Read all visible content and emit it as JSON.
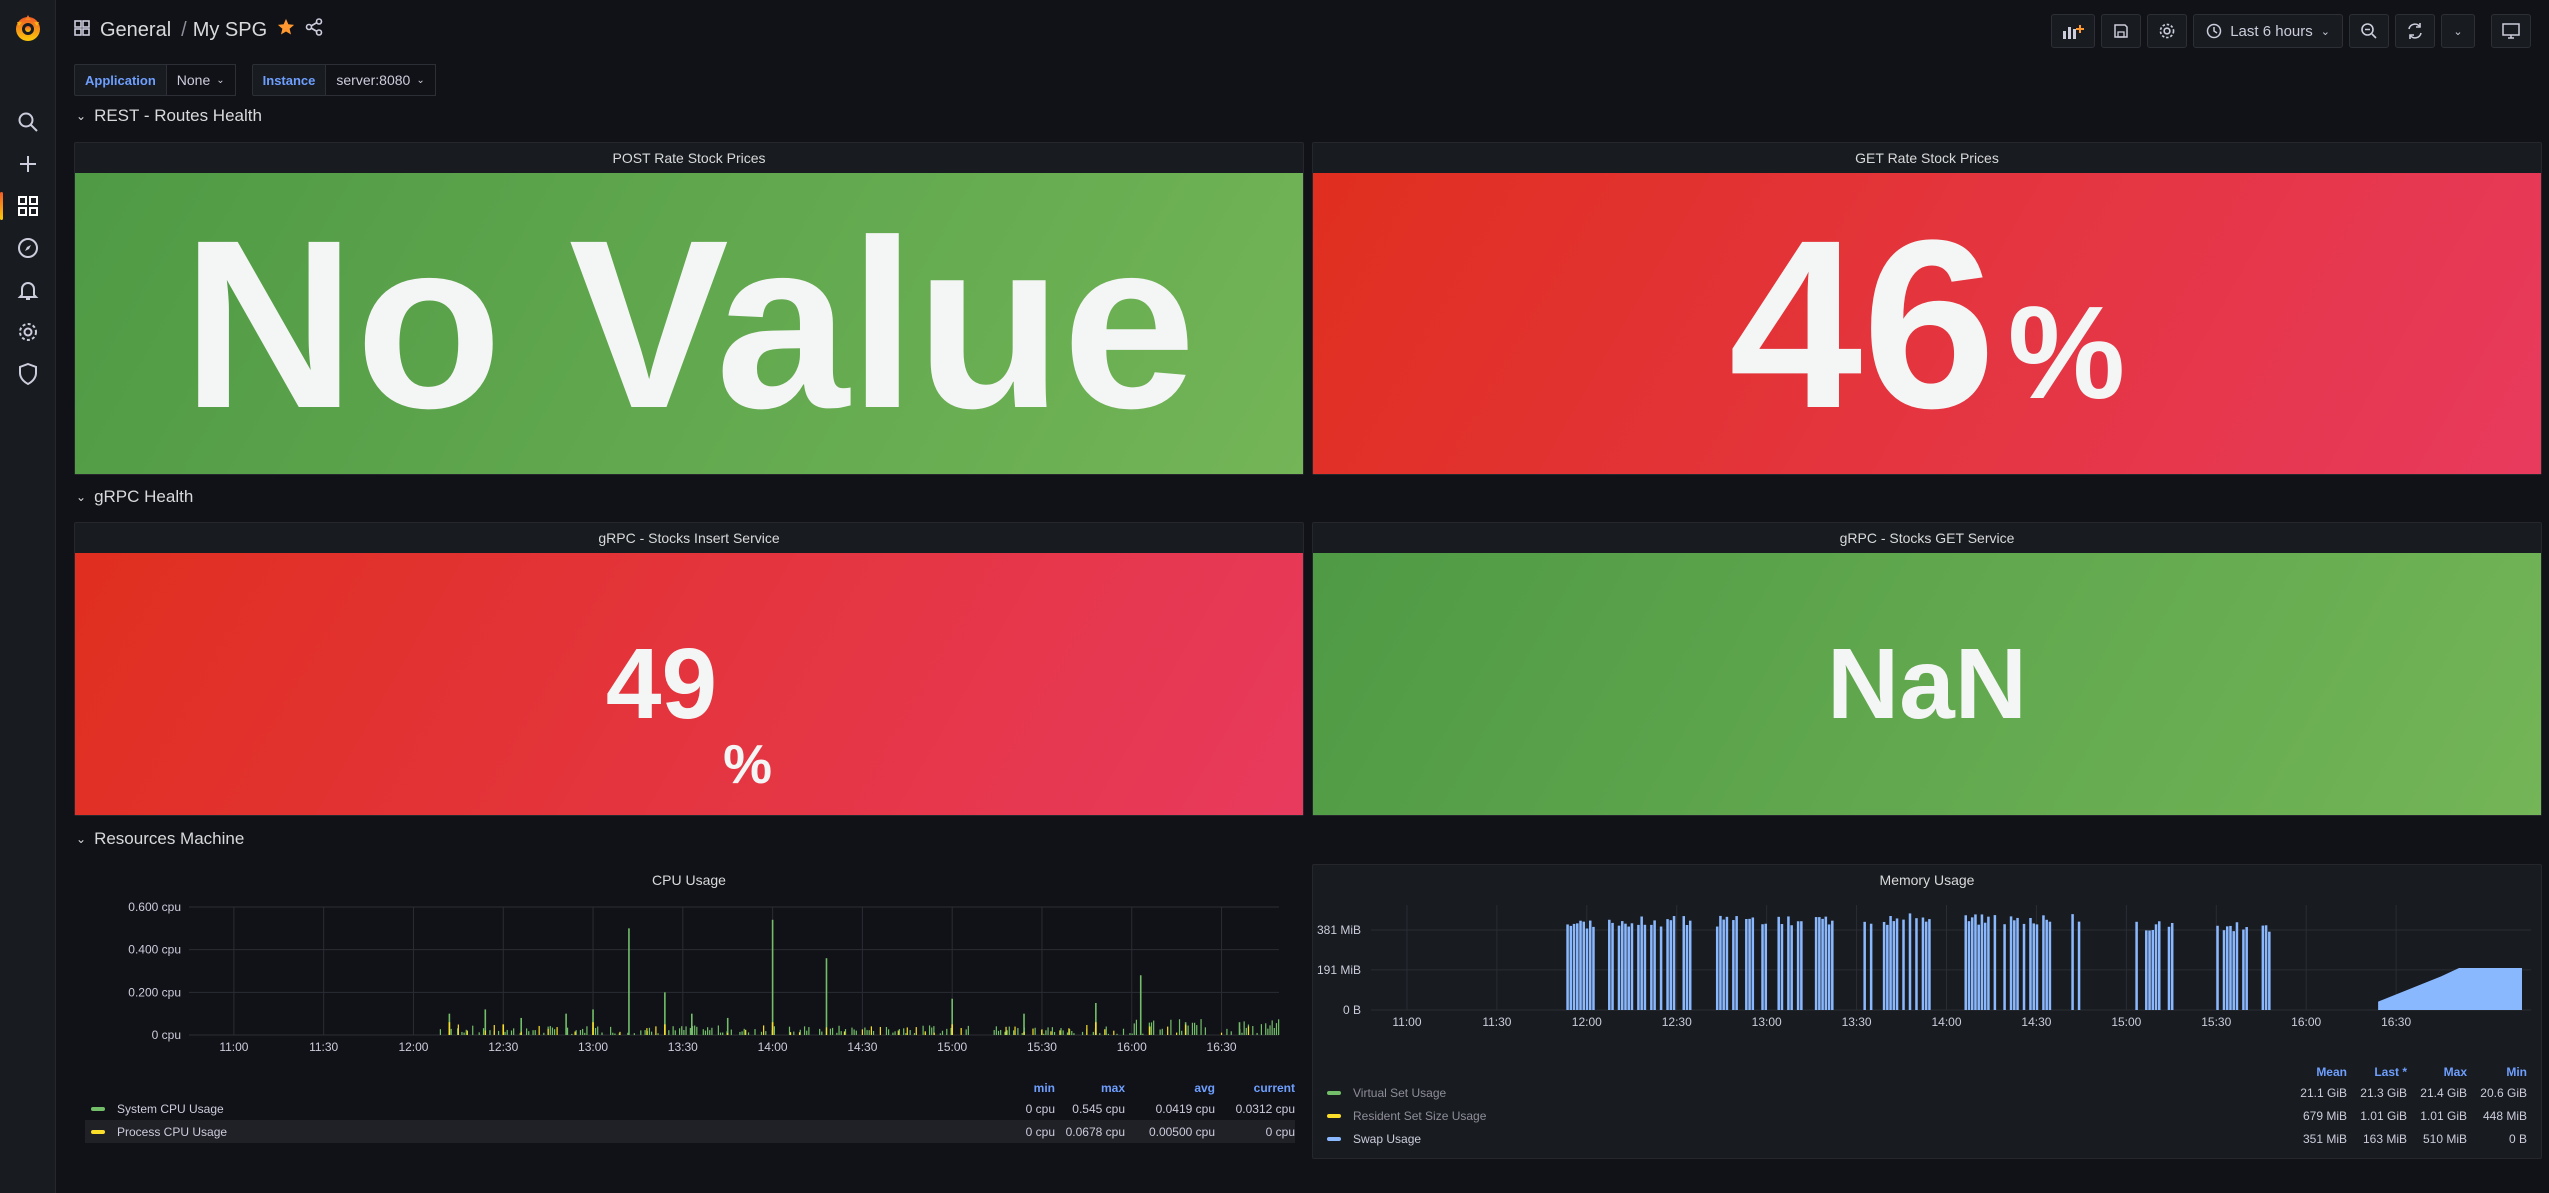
{
  "breadcrumb": {
    "folder": "General",
    "separator": "/",
    "dashboard": "My SPG"
  },
  "toolbar": {
    "time_range": "Last 6 hours"
  },
  "variables": [
    {
      "label": "Application",
      "value": "None"
    },
    {
      "label": "Instance",
      "value": "server:8080"
    }
  ],
  "rows": {
    "rest": "REST - Routes Health",
    "grpc": "gRPC Health",
    "resources": "Resources Machine"
  },
  "panels": {
    "post_rate": {
      "title": "POST Rate Stock Prices",
      "value": "No Value",
      "unit": "",
      "color": "#73b557"
    },
    "get_rate": {
      "title": "GET Rate Stock Prices",
      "value": "46",
      "unit": "%",
      "color": "#e02f44"
    },
    "grpc_insert": {
      "title": "gRPC - Stocks Insert Service",
      "value": "49",
      "unit": "%",
      "color": "#e02f44"
    },
    "grpc_get": {
      "title": "gRPC - Stocks GET Service",
      "value": "NaN",
      "unit": "",
      "color": "#73b557"
    }
  },
  "cpu": {
    "title": "CPU Usage",
    "legend_headers": [
      "min",
      "max",
      "avg",
      "current"
    ],
    "series": [
      {
        "name": "System CPU Usage",
        "color": "#73bf69",
        "min": "0 cpu",
        "max": "0.545 cpu",
        "avg": "0.0419 cpu",
        "current": "0.0312 cpu"
      },
      {
        "name": "Process CPU Usage",
        "color": "#fade2a",
        "min": "0 cpu",
        "max": "0.0678 cpu",
        "avg": "0.00500 cpu",
        "current": "0 cpu"
      }
    ]
  },
  "memory": {
    "title": "Memory Usage",
    "legend_headers": [
      "Mean",
      "Last *",
      "Max",
      "Min"
    ],
    "series": [
      {
        "name": "Virtual Set Usage",
        "color": "#73bf69",
        "mean": "21.1 GiB",
        "last": "21.3 GiB",
        "max": "21.4 GiB",
        "min": "20.6 GiB"
      },
      {
        "name": "Resident Set Size Usage",
        "color": "#fade2a",
        "mean": "679 MiB",
        "last": "1.01 GiB",
        "max": "1.01 GiB",
        "min": "448 MiB"
      },
      {
        "name": "Swap Usage",
        "color": "#8ab8ff",
        "mean": "351 MiB",
        "last": "163 MiB",
        "max": "510 MiB",
        "min": "0 B"
      }
    ]
  },
  "chart_data": [
    {
      "type": "line",
      "title": "CPU Usage",
      "x": [
        "11:00",
        "11:30",
        "12:00",
        "12:30",
        "13:00",
        "13:30",
        "14:00",
        "14:30",
        "15:00",
        "15:30",
        "16:00",
        "16:30"
      ],
      "yticks": [
        "0 cpu",
        "0.200 cpu",
        "0.400 cpu",
        "0.600 cpu"
      ],
      "ylim": [
        0,
        0.6
      ],
      "series": [
        {
          "name": "System CPU Usage",
          "spikes": [
            [
              12.2,
              0.1
            ],
            [
              12.4,
              0.12
            ],
            [
              12.6,
              0.08
            ],
            [
              12.85,
              0.1
            ],
            [
              13.0,
              0.12
            ],
            [
              13.2,
              0.5
            ],
            [
              13.4,
              0.2
            ],
            [
              13.55,
              0.1
            ],
            [
              13.75,
              0.08
            ],
            [
              14.0,
              0.54
            ],
            [
              14.3,
              0.36
            ],
            [
              15.0,
              0.17
            ],
            [
              15.4,
              0.1
            ],
            [
              15.8,
              0.15
            ],
            [
              16.05,
              0.28
            ],
            [
              16.3,
              0.06
            ],
            [
              16.6,
              0.06
            ]
          ]
        },
        {
          "name": "Process CPU Usage",
          "spikes": [
            [
              12.2,
              0.06
            ],
            [
              12.5,
              0.05
            ],
            [
              13.0,
              0.06
            ],
            [
              13.4,
              0.05
            ],
            [
              14.0,
              0.06
            ],
            [
              15.0,
              0.05
            ],
            [
              15.8,
              0.06
            ],
            [
              16.1,
              0.04
            ]
          ]
        }
      ]
    },
    {
      "type": "area",
      "title": "Memory Usage",
      "x": [
        "11:00",
        "11:30",
        "12:00",
        "12:30",
        "13:00",
        "13:30",
        "14:00",
        "14:30",
        "15:00",
        "15:30",
        "16:00",
        "16:30"
      ],
      "yticks": [
        "0 B",
        "191 MiB",
        "381 MiB"
      ],
      "series": [
        {
          "name": "Swap Usage",
          "blocks": [
            [
              11.85,
              12.05,
              440
            ],
            [
              12.1,
              12.6,
              450
            ],
            [
              12.7,
              13.2,
              450
            ],
            [
              13.25,
              13.9,
              460
            ],
            [
              14.1,
              14.75,
              460
            ],
            [
              15.05,
              15.25,
              430
            ],
            [
              15.5,
              15.8,
              420
            ],
            [
              16.4,
              17.2,
              200
            ]
          ]
        }
      ]
    }
  ]
}
